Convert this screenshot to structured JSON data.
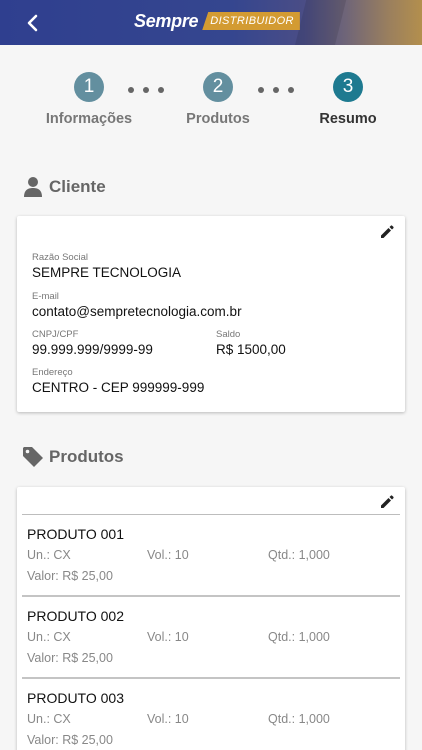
{
  "header": {
    "logo_word": "Sempre",
    "logo_tag": "DISTRIBUIDOR",
    "gradient_start": "#2f3f8f",
    "gradient_end": "#b38f4d"
  },
  "stepper": {
    "steps": [
      {
        "number": "1",
        "label": "Informações",
        "active": false
      },
      {
        "number": "2",
        "label": "Produtos",
        "active": false
      },
      {
        "number": "3",
        "label": "Resumo",
        "active": true
      }
    ],
    "inactive_color": "#638f9f",
    "active_color": "#1e7a90"
  },
  "cliente": {
    "section_title": "Cliente",
    "section_icon": "person-icon",
    "edit_icon": "pencil-icon",
    "razao_label": "Razão Social",
    "razao_value": "SEMPRE TECNOLOGIA",
    "email_label": "E-mail",
    "email_value": "contato@sempretecnologia.com.br",
    "cnpj_label": "CNPJ/CPF",
    "cnpj_value": "99.999.999/9999-99",
    "saldo_label": "Saldo",
    "saldo_value": "R$ 1500,00",
    "endereco_label": "Endereço",
    "endereco_value": "CENTRO - CEP 999999-999"
  },
  "produtos": {
    "section_title": "Produtos",
    "section_icon": "tag-icon",
    "edit_icon": "pencil-icon",
    "items": [
      {
        "name": "PRODUTO 001",
        "un": "Un.: CX",
        "vol": "Vol.: 10",
        "qtd": "Qtd.: 1,000",
        "valor": "Valor: R$ 25,00"
      },
      {
        "name": "PRODUTO 002",
        "un": "Un.: CX",
        "vol": "Vol.: 10",
        "qtd": "Qtd.: 1,000",
        "valor": "Valor: R$ 25,00"
      },
      {
        "name": "PRODUTO 003",
        "un": "Un.: CX",
        "vol": "Vol.: 10",
        "qtd": "Qtd.: 1,000",
        "valor": "Valor: R$ 25,00"
      }
    ]
  }
}
